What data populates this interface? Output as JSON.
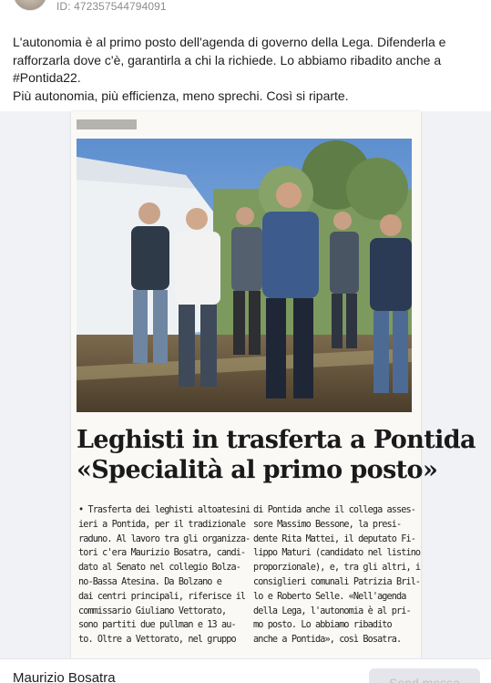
{
  "post": {
    "id_label": "ID: 472357544794091",
    "text_lines": [
      "L'autonomia è al primo posto dell'agenda di governo della Lega. Difenderla e",
      "rafforzarla dove c'è, garantirla a chi la richiede. Lo abbiamo ribadito anche a",
      "#Pontida22.",
      "Più autonomia, più efficienza, meno sprechi. Così si riparte."
    ]
  },
  "clipping": {
    "headline_line1": "Leghisti in trasferta a Pontida",
    "headline_line2": "«Specialità al primo posto»",
    "left_column": [
      "• Trasferta dei leghisti altoatesini",
      "ieri a Pontida, per il tradizionale",
      "raduno. Al lavoro tra gli organizza-",
      "tori c'era Maurizio Bosatra, candi-",
      "dato al Senato nel collegio Bolza-",
      "no-Bassa Atesina. Da Bolzano e",
      "dai centri principali, riferisce il",
      "commissario Giuliano Vettorato,",
      "sono partiti due pullman e 13 au-",
      "to. Oltre a Vettorato, nel gruppo"
    ],
    "right_column": [
      "di Pontida anche il collega asses-",
      "sore Massimo Bessone, la presi-",
      "dente Rita Mattei, il deputato Fi-",
      "lippo Maturi (candidato nel listino",
      "proporzionale), e, tra gli altri, i",
      "consiglieri comunali Patrizia Bril-",
      "lo e Roberto Selle. «Nell'agenda",
      "della Lega, l'autonomia è al pri-",
      "mo posto. Lo abbiamo ribadito",
      "anche a Pontida», così Bosatra."
    ]
  },
  "footer": {
    "author": "Maurizio Bosatra",
    "send_label": "Send messa"
  },
  "colors": {
    "accent_bullet": "#c0392b",
    "kicker_bar": "#b4b4ae",
    "button_bg": "#e4e6eb"
  }
}
